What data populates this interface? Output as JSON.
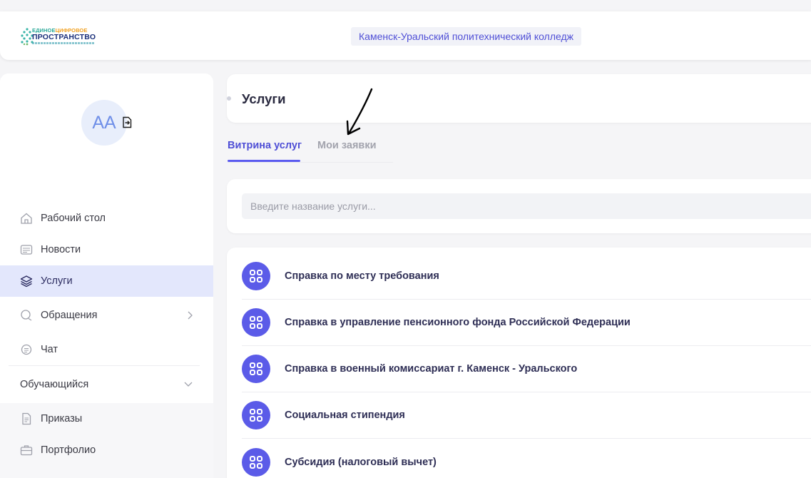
{
  "header": {
    "logo": {
      "line1_a": "ЕДИНОЕ",
      "line1_b": "ЦИФРОВОЕ",
      "line2": "ПРОСТРАНСТВО"
    },
    "organization": "Каменск-Уральский политехнический колледж"
  },
  "user": {
    "initials": "АА"
  },
  "sidebar": {
    "items": [
      {
        "label": "Рабочий стол",
        "icon": "home-icon"
      },
      {
        "label": "Новости",
        "icon": "news-icon"
      },
      {
        "label": "Услуги",
        "icon": "layers-icon",
        "active": true
      },
      {
        "label": "Обращения",
        "icon": "chat-bubbles-icon"
      },
      {
        "label": "Чат",
        "icon": "chat-icon"
      }
    ],
    "section": {
      "label": "Обучающийся",
      "items": [
        {
          "label": "Приказы",
          "icon": "document-icon"
        },
        {
          "label": "Портфолио",
          "icon": "briefcase-icon"
        }
      ]
    }
  },
  "main": {
    "title": "Услуги",
    "tabs": [
      {
        "label": "Витрина услуг",
        "active": true
      },
      {
        "label": "Мои заявки",
        "active": false
      }
    ],
    "search": {
      "placeholder": "Введите название услуги...",
      "value": ""
    },
    "services": [
      "Справка по месту требования",
      "Справка в управление пенсионного фонда Российской Федерации",
      "Справка в военный комиссариат г. Каменск - Уральского",
      "Социальная стипендия",
      "Субсидия (налоговый вычет)"
    ]
  },
  "colors": {
    "accent": "#5b5bf0",
    "accent_text": "#4f4fd6",
    "active_nav_bg": "#e3e7fc",
    "service_icon_bg": "#5b5be8"
  }
}
